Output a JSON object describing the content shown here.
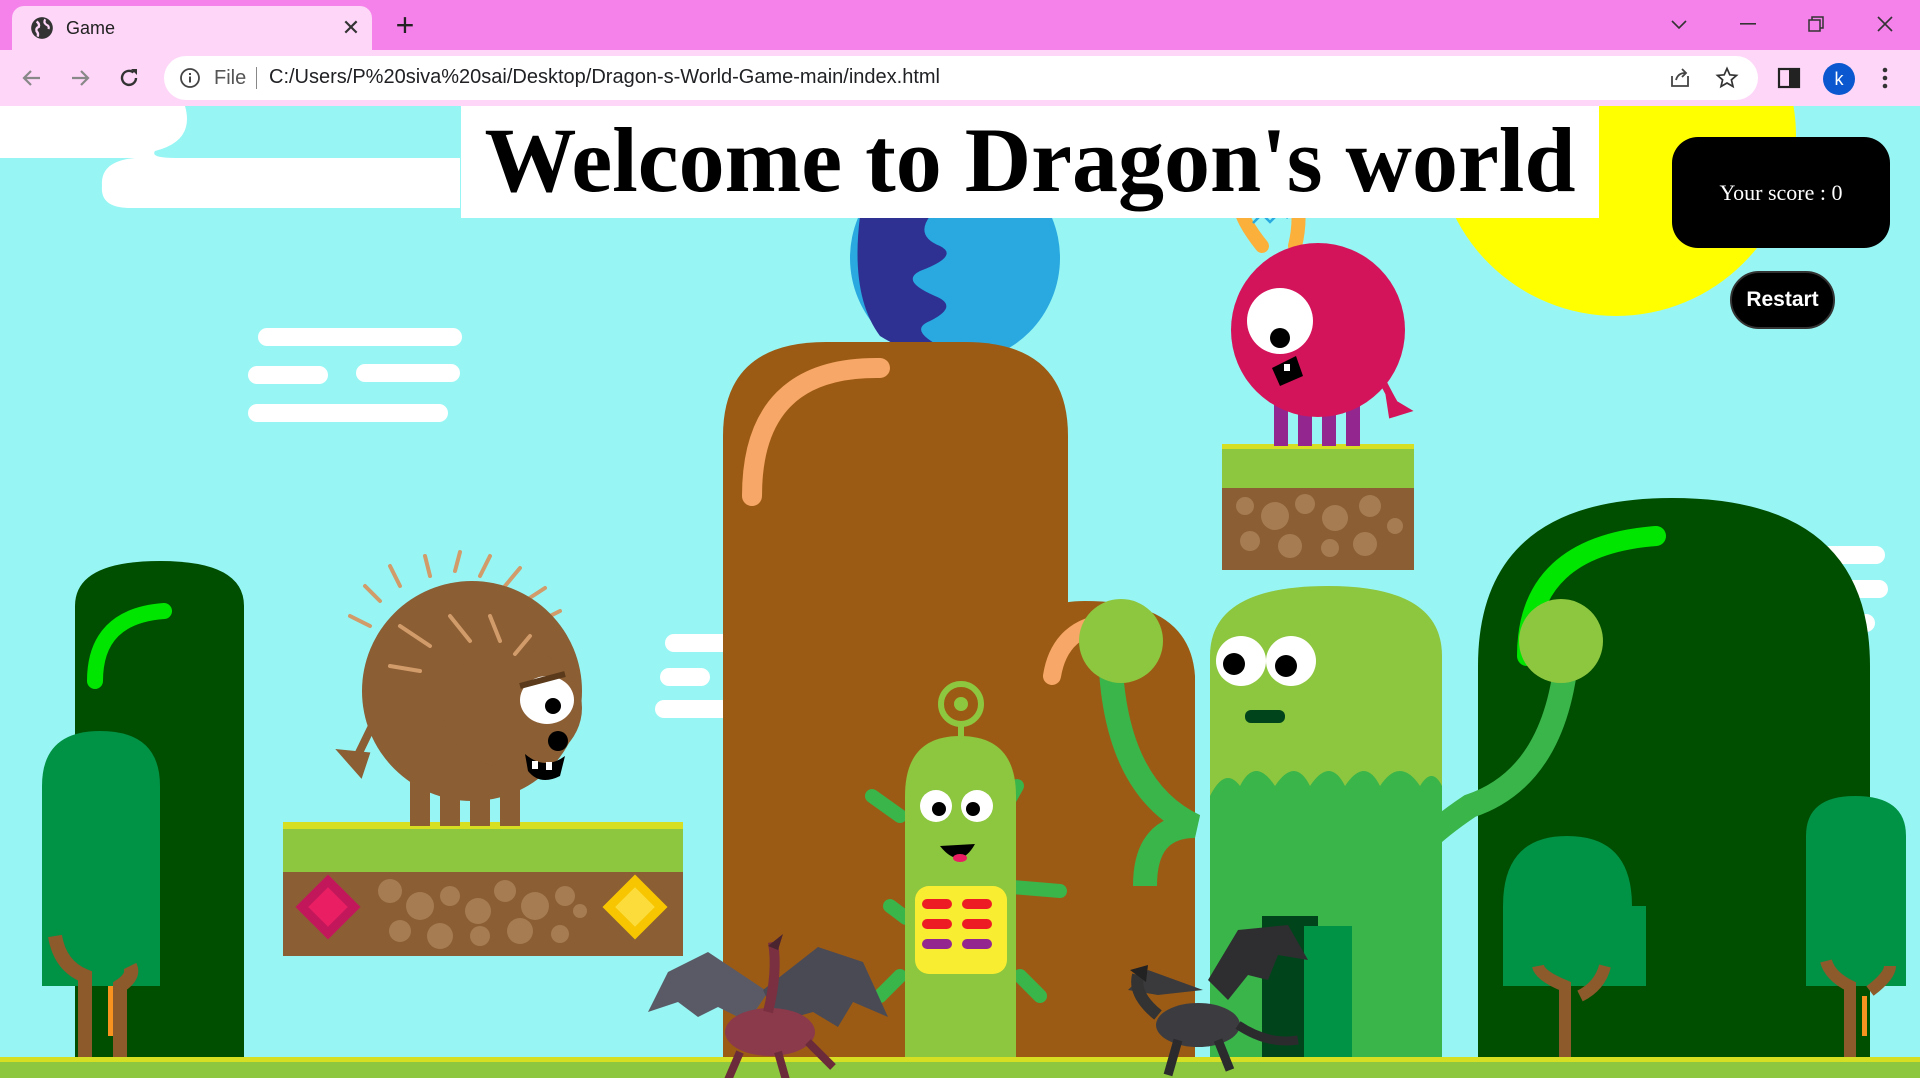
{
  "browser": {
    "tab_title": "Game",
    "new_tab_label": "+",
    "address_prefix": "File",
    "url": "C:/Users/P%20siva%20sai/Desktop/Dragon-s-World-Game-main/index.html",
    "profile_initial": "k"
  },
  "game": {
    "title": "Welcome to Dragon's world",
    "score_text": "Your score : 0",
    "restart_label": "Restart"
  },
  "icons": [
    "globe-icon",
    "close-icon",
    "chevron-down-icon",
    "minimize-icon",
    "restore-icon",
    "window-close-icon",
    "back-arrow-icon",
    "forward-arrow-icon",
    "reload-icon",
    "info-icon",
    "share-icon",
    "star-icon",
    "side-panel-icon",
    "kebab-menu-icon"
  ],
  "colors": {
    "tabbar": "#f582ea",
    "toolbar": "#fdd6f8",
    "sky": "#97f6f4",
    "grass": "#8dc63f",
    "score_box": "#000000",
    "sun": "#ffff00"
  }
}
